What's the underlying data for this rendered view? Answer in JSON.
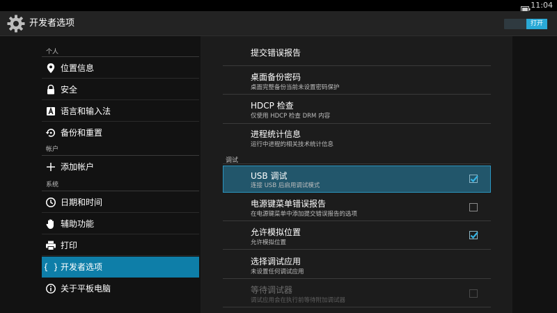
{
  "status_bar": {
    "time": "11:04",
    "battery_icon": "battery-icon"
  },
  "action_bar": {
    "title": "开发者选项",
    "app_icon": "settings-gear-icon",
    "toggle_label": "打开",
    "toggle_on": true
  },
  "sidebar": {
    "sections": {
      "personal": "个人",
      "accounts": "帐户",
      "system": "系统"
    },
    "items": {
      "location": {
        "label": "位置信息",
        "icon": "location-pin-icon"
      },
      "security": {
        "label": "安全",
        "icon": "lock-icon"
      },
      "language": {
        "label": "语言和输入法",
        "icon": "keyboard-a-icon"
      },
      "backup": {
        "label": "备份和重置",
        "icon": "backup-restore-icon"
      },
      "add_account": {
        "label": "添加帐户",
        "icon": "plus-icon"
      },
      "date_time": {
        "label": "日期和时间",
        "icon": "clock-icon"
      },
      "accessibility": {
        "label": "辅助功能",
        "icon": "hand-icon"
      },
      "print": {
        "label": "打印",
        "icon": "printer-icon"
      },
      "developer": {
        "label": "开发者选项",
        "icon": "braces-icon",
        "selected": true
      },
      "about": {
        "label": "关于平板电脑",
        "icon": "info-icon"
      }
    }
  },
  "detail": {
    "bug_report": {
      "title": "提交错误报告"
    },
    "desktop_backup": {
      "title": "桌面备份密码",
      "summary": "桌面完整备份当前未设置密码保护"
    },
    "hdcp": {
      "title": "HDCP 检查",
      "summary": "仅使用 HDCP 检查 DRM 内容"
    },
    "process_stats": {
      "title": "进程统计信息",
      "summary": "运行中进程的相关技术统计信息"
    },
    "debugging_category": "调试",
    "usb_debugging": {
      "title": "USB 调试",
      "summary": "连接 USB 后启用调试模式",
      "checked": true
    },
    "power_menu_bug": {
      "title": "电源键菜单错误报告",
      "summary": "在电源键菜单中添加提交错误报告的选项",
      "checked": false
    },
    "mock_locations": {
      "title": "允许模拟位置",
      "summary": "允许模拟位置",
      "checked": true
    },
    "debug_app": {
      "title": "选择调试应用",
      "summary": "未设置任何调试应用"
    },
    "wait_debugger": {
      "title": "等待调试器",
      "summary": "调试应用会在执行前等待附加调试器",
      "checked": false,
      "disabled": true
    }
  },
  "colors": {
    "accent": "#2aa9d6",
    "selected_sidebar": "#0e7ea8",
    "highlight_row": "#22566b",
    "checkmark": "#35b5e5"
  }
}
